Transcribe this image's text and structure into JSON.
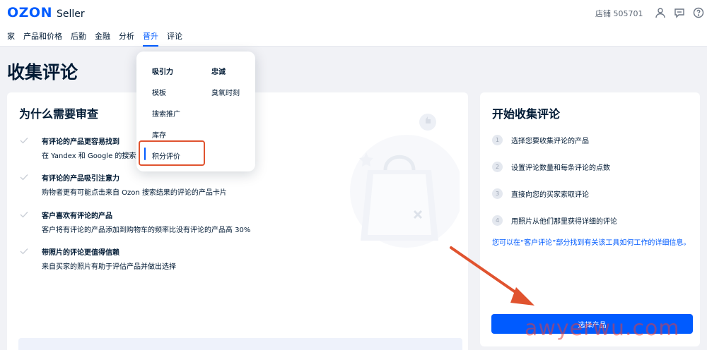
{
  "header": {
    "logo_brand": "OZON",
    "logo_suffix": "Seller",
    "store_label": "店铺 505701",
    "icons": [
      "user-icon",
      "chat-icon",
      "help-icon"
    ]
  },
  "nav": {
    "items": [
      {
        "label": "家",
        "active": false
      },
      {
        "label": "产品和价格",
        "active": false
      },
      {
        "label": "后勤",
        "active": false
      },
      {
        "label": "金融",
        "active": false
      },
      {
        "label": "分析",
        "active": false
      },
      {
        "label": "晋升",
        "active": true
      },
      {
        "label": "评论",
        "active": false
      }
    ]
  },
  "page": {
    "title": "收集评论"
  },
  "why": {
    "title": "为什么需要审查",
    "reasons": [
      {
        "title": "有评论的产品更容易找到",
        "desc": "在 Yandex 和 Google 的搜索结"
      },
      {
        "title": "有评论的产品吸引注意力",
        "desc": "购物者更有可能点击来自 Ozon 搜索结果的评论的产品卡片"
      },
      {
        "title": "客户喜欢有评论的产品",
        "desc": "客户将有评论的产品添加到购物车的频率比没有评论的产品高 30%"
      },
      {
        "title": "带照片的评论更值得信赖",
        "desc": "来自买家的照片有助于评估产品并做出选择"
      }
    ]
  },
  "start": {
    "title": "开始收集评论",
    "steps": [
      {
        "num": "1",
        "text": "选择您要收集评论的产品"
      },
      {
        "num": "2",
        "text": "设置评论数量和每条评论的点数"
      },
      {
        "num": "3",
        "text": "直接向您的买家索取评论"
      },
      {
        "num": "4",
        "text": "用照片从他们那里获得详细的评论"
      }
    ],
    "info_link": "您可以在“客户评论”部分找到有关该工具如何工作的详细信息。",
    "button_label": "选择产品"
  },
  "dropdown": {
    "col1": [
      "吸引力",
      "模板",
      "搜索推广",
      "库存",
      "积分评价"
    ],
    "col2": [
      "忠诚",
      "臭氧时刻"
    ],
    "selected": "积分评价"
  },
  "watermark": "awyerwu.com",
  "colors": {
    "accent": "#005bff",
    "annotation": "#e0532f",
    "background": "#f1f2f6"
  }
}
